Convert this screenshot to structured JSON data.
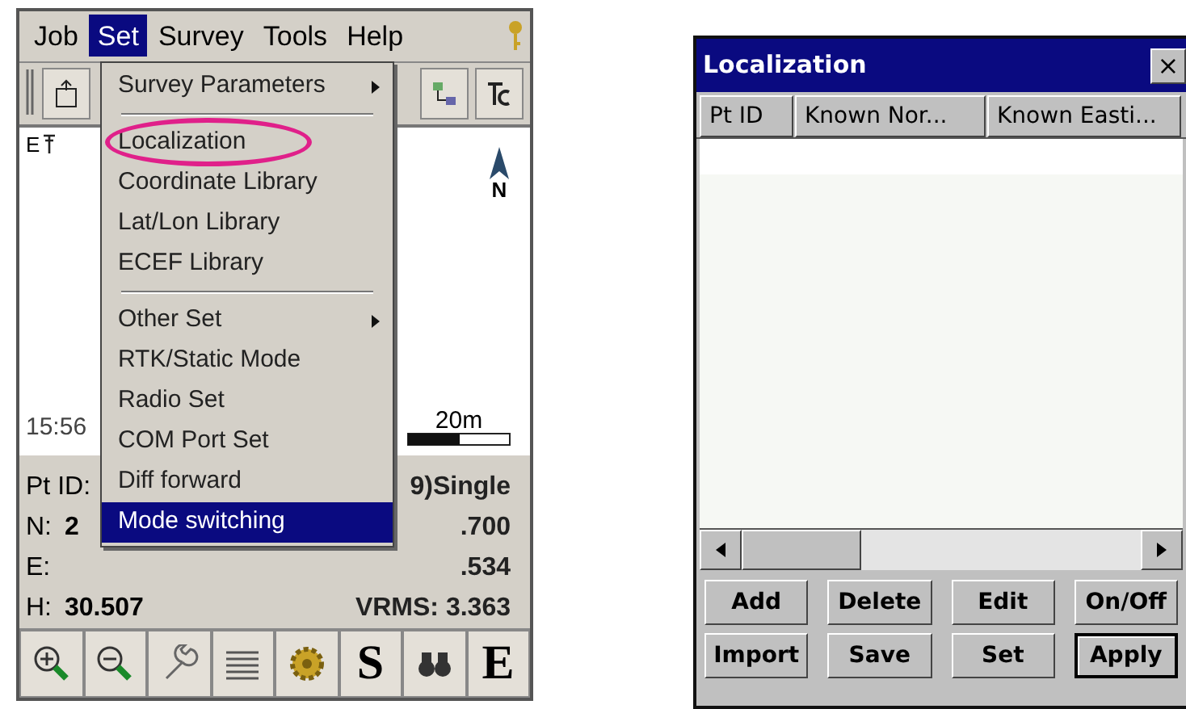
{
  "device_screen": {
    "menubar": [
      {
        "label": "Job",
        "selected": false
      },
      {
        "label": "Set",
        "selected": true
      },
      {
        "label": "Survey",
        "selected": false
      },
      {
        "label": "Tools",
        "selected": false
      },
      {
        "label": "Help",
        "selected": false
      }
    ],
    "open_menu": [
      {
        "kind": "submenu",
        "label": "Survey Parameters",
        "selected": false,
        "circled": false
      },
      {
        "kind": "separator"
      },
      {
        "kind": "item",
        "label": "Localization",
        "selected": false,
        "circled": true
      },
      {
        "kind": "item",
        "label": "Coordinate Library",
        "selected": false,
        "circled": false
      },
      {
        "kind": "item",
        "label": "Lat/Lon Library",
        "selected": false,
        "circled": false
      },
      {
        "kind": "item",
        "label": "ECEF Library",
        "selected": false,
        "circled": false
      },
      {
        "kind": "separator"
      },
      {
        "kind": "submenu",
        "label": "Other Set",
        "selected": false,
        "circled": false
      },
      {
        "kind": "item",
        "label": "RTK/Static Mode",
        "selected": false,
        "circled": false
      },
      {
        "kind": "item",
        "label": "Radio Set",
        "selected": false,
        "circled": false
      },
      {
        "kind": "item",
        "label": "COM Port Set",
        "selected": false,
        "circled": false
      },
      {
        "kind": "item",
        "label": "Diff forward",
        "selected": false,
        "circled": false
      },
      {
        "kind": "item",
        "label": "Mode switching",
        "selected": true,
        "circled": false
      }
    ],
    "map": {
      "corner_label": "E",
      "north_label": "N",
      "time": "15:56",
      "scale": "20m"
    },
    "status_rows": [
      {
        "label": "Pt ID:",
        "value": "",
        "right": "9)Single"
      },
      {
        "label": "N:",
        "value": "2",
        "right": ".700"
      },
      {
        "label": "E:",
        "value": "",
        "right": ".534"
      },
      {
        "label": "H:",
        "value": "30.507",
        "right": "VRMS: 3.363"
      }
    ],
    "letter_buttons": [
      "S",
      "E"
    ]
  },
  "localization_dialog": {
    "title": "Localization",
    "close": "×",
    "columns": [
      "Pt ID",
      "Known Nor...",
      "Known Easti..."
    ],
    "buttons": [
      {
        "label": "Add",
        "default": false
      },
      {
        "label": "Delete",
        "default": false
      },
      {
        "label": "Edit",
        "default": false
      },
      {
        "label": "On/Off",
        "default": false
      },
      {
        "label": "Import",
        "default": false
      },
      {
        "label": "Save",
        "default": false
      },
      {
        "label": "Set",
        "default": false
      },
      {
        "label": "Apply",
        "default": true
      }
    ]
  }
}
